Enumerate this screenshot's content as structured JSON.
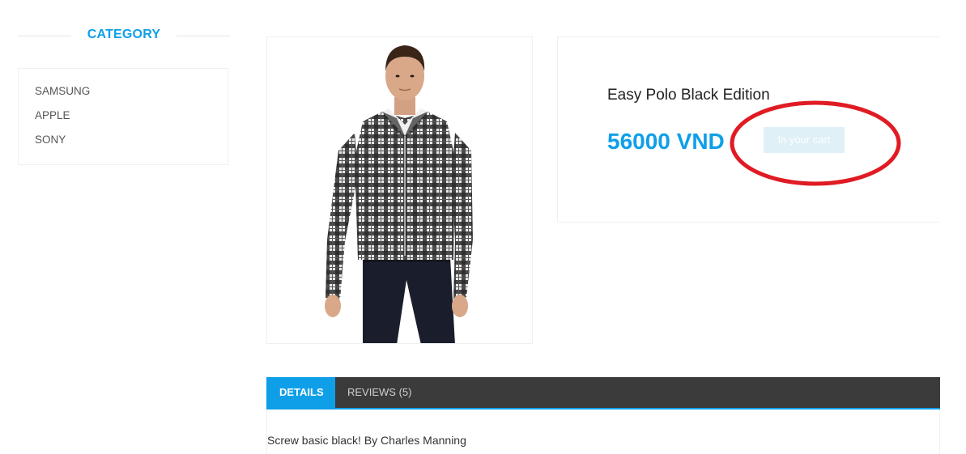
{
  "sidebar": {
    "heading": "CATEGORY",
    "categories": [
      {
        "label": "SAMSUNG"
      },
      {
        "label": "APPLE"
      },
      {
        "label": "SONY"
      }
    ]
  },
  "product": {
    "image_subject": "man in black and white plaid shirt and dark jeans",
    "name": "Easy Polo Black Edition",
    "price": "56000 VND",
    "cart_button_label": "In your cart"
  },
  "tabs": {
    "items": [
      {
        "label": "DETAILS",
        "active": true
      },
      {
        "label": "REVIEWS (5)",
        "active": false
      }
    ]
  },
  "details": {
    "description": "Screw basic black! By Charles Manning"
  },
  "colors": {
    "accent": "#0f9fe8",
    "tab_bar": "#3b3b3b",
    "annotation": "#e01b24",
    "cart_button_bg": "#dff0f7"
  }
}
